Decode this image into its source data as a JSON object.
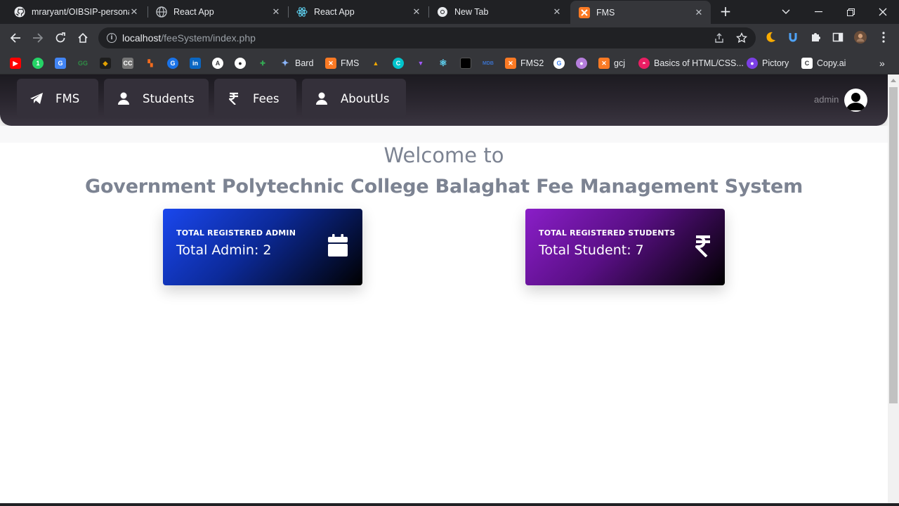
{
  "browser": {
    "tabs": [
      {
        "title": "mraryant/OIBSIP-personal",
        "favicon": "github-icon",
        "active": false
      },
      {
        "title": "React App",
        "favicon": "globe-icon",
        "active": false
      },
      {
        "title": "React App",
        "favicon": "react-icon",
        "active": false
      },
      {
        "title": "New Tab",
        "favicon": "chrome-icon",
        "active": false
      },
      {
        "title": "FMS",
        "favicon": "xampp-icon",
        "active": true
      }
    ],
    "url_host": "localhost",
    "url_path": "/feeSystem/index.php",
    "bookmarks": [
      {
        "label": "",
        "icon": "youtube-icon",
        "color": "#ff0000"
      },
      {
        "label": "",
        "icon": "whatsapp-icon",
        "color": "#25d366"
      },
      {
        "label": "",
        "icon": "google-translate-icon",
        "color": "#4285f4"
      },
      {
        "label": "",
        "icon": "geeksforgeeks-icon",
        "color": "#2f8d46"
      },
      {
        "label": "",
        "icon": "bookmark-icon",
        "color": "#e2a100"
      },
      {
        "label": "",
        "icon": "cc-icon",
        "color": "#777777"
      },
      {
        "label": "",
        "icon": "extension-icon",
        "color": "#f26b1d"
      },
      {
        "label": "",
        "icon": "extension-icon",
        "color": "#1a73e8"
      },
      {
        "label": "",
        "icon": "linkedin-icon",
        "color": "#0a66c2"
      },
      {
        "label": "",
        "icon": "extension-icon",
        "color": "#ffffff"
      },
      {
        "label": "",
        "icon": "github-icon",
        "color": "#ffffff"
      },
      {
        "label": "",
        "icon": "extension-icon",
        "color": "#34a853"
      },
      {
        "label": "Bard",
        "icon": "bard-icon",
        "color": "#8ab4f8"
      },
      {
        "label": "FMS",
        "icon": "xampp-icon",
        "color": "#fb7a24"
      },
      {
        "label": "",
        "icon": "extension-icon",
        "color": "#f2a900"
      },
      {
        "label": "",
        "icon": "canva-icon",
        "color": "#00c4cc"
      },
      {
        "label": "",
        "icon": "vite-icon",
        "color": "#a259ff"
      },
      {
        "label": "",
        "icon": "react-icon",
        "color": "#61dafb"
      },
      {
        "label": "",
        "icon": "extension-icon",
        "color": "#000000"
      },
      {
        "label": "",
        "icon": "mdb-icon",
        "color": "#3b71ca"
      },
      {
        "label": "FMS2",
        "icon": "xampp-icon",
        "color": "#fb7a24"
      },
      {
        "label": "",
        "icon": "google-icon",
        "color": "#ffffff"
      },
      {
        "label": "",
        "icon": "avatar-icon",
        "color": "#b57edc"
      },
      {
        "label": "gcj",
        "icon": "xampp-icon",
        "color": "#fb7a24"
      },
      {
        "label": "Basics of HTML/CSS...",
        "icon": "extension-icon",
        "color": "#e91e63"
      },
      {
        "label": "Pictory",
        "icon": "pictory-icon",
        "color": "#7b3fe4"
      },
      {
        "label": "Copy.ai",
        "icon": "copyai-icon",
        "color": "#ffffff"
      }
    ]
  },
  "nav": {
    "items": [
      {
        "label": "FMS",
        "icon": "paper-plane-icon"
      },
      {
        "label": "Students",
        "icon": "user-icon"
      },
      {
        "label": "Fees",
        "icon": "rupee-icon"
      },
      {
        "label": "AboutUs",
        "icon": "user-icon"
      }
    ],
    "user": "admin"
  },
  "main": {
    "welcome": "Welcome to",
    "college": "Government Polytechnic College Balaghat Fee Management System",
    "cards": [
      {
        "label": "TOTAL REGISTERED ADMIN",
        "value": "Total Admin: 2",
        "icon": "calendar-icon",
        "color_start": "#1a47ee",
        "color_end": "#000000"
      },
      {
        "label": "TOTAL REGISTERED STUDENTS",
        "value": "Total Student: 7",
        "icon": "rupee-icon",
        "color_start": "#8a1ec8",
        "color_end": "#000000"
      }
    ]
  }
}
